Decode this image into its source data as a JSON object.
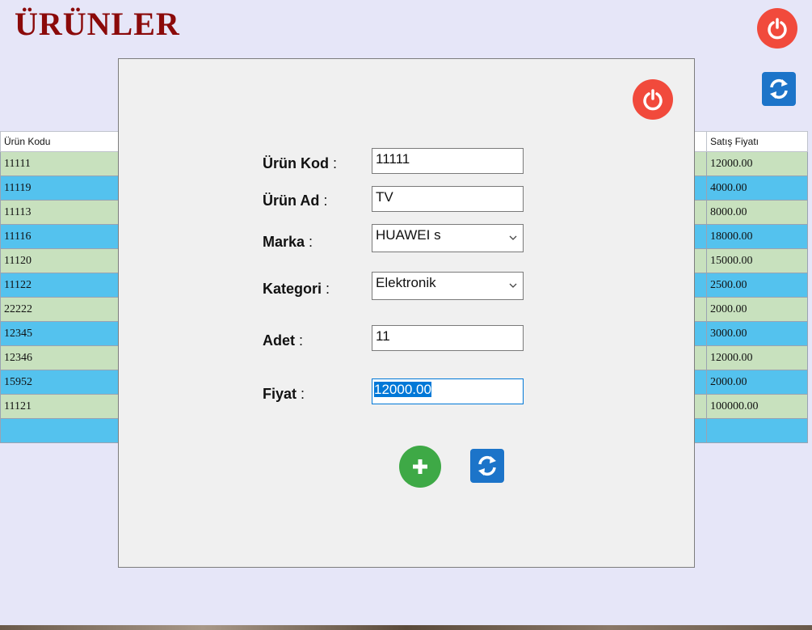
{
  "window": {
    "title": "ÜRÜNLER"
  },
  "header_buttons": {
    "power_icon": "power-icon",
    "refresh_icon": "refresh-icon"
  },
  "grid": {
    "left_header": "Ürün Kodu",
    "right_header": "Satış Fiyatı",
    "rows": [
      {
        "code": "11111",
        "price": "12000.00"
      },
      {
        "code": "11119",
        "price": "4000.00"
      },
      {
        "code": "11113",
        "price": "8000.00"
      },
      {
        "code": "11116",
        "price": "18000.00"
      },
      {
        "code": "11120",
        "price": "15000.00"
      },
      {
        "code": "11122",
        "price": "2500.00"
      },
      {
        "code": "22222",
        "price": "2000.00"
      },
      {
        "code": "12345",
        "price": "3000.00"
      },
      {
        "code": "12346",
        "price": "12000.00"
      },
      {
        "code": "15952",
        "price": "2000.00"
      },
      {
        "code": "11121",
        "price": "100000.00"
      },
      {
        "code": "",
        "price": ""
      }
    ]
  },
  "form": {
    "kod_label": "Ürün Kod",
    "ad_label": "Ürün Ad",
    "marka_label": "Marka",
    "kategori_label": "Kategori",
    "adet_label": "Adet",
    "fiyat_label": "Fiyat",
    "colon": ":",
    "kod_value": "11111",
    "ad_value": "TV",
    "marka_value": "HUAWEI s",
    "kategori_value": "Elektronik",
    "adet_value": "11",
    "fiyat_value": "12000.00"
  },
  "colors": {
    "title": "#8b0a0a",
    "power": "#f14a3c",
    "refresh": "#1c74c9",
    "add": "#3ea946",
    "row_odd": "#c8e1be",
    "row_even": "#54c2ee",
    "background": "#e6e6f8",
    "dialog": "#f0f0f0"
  }
}
